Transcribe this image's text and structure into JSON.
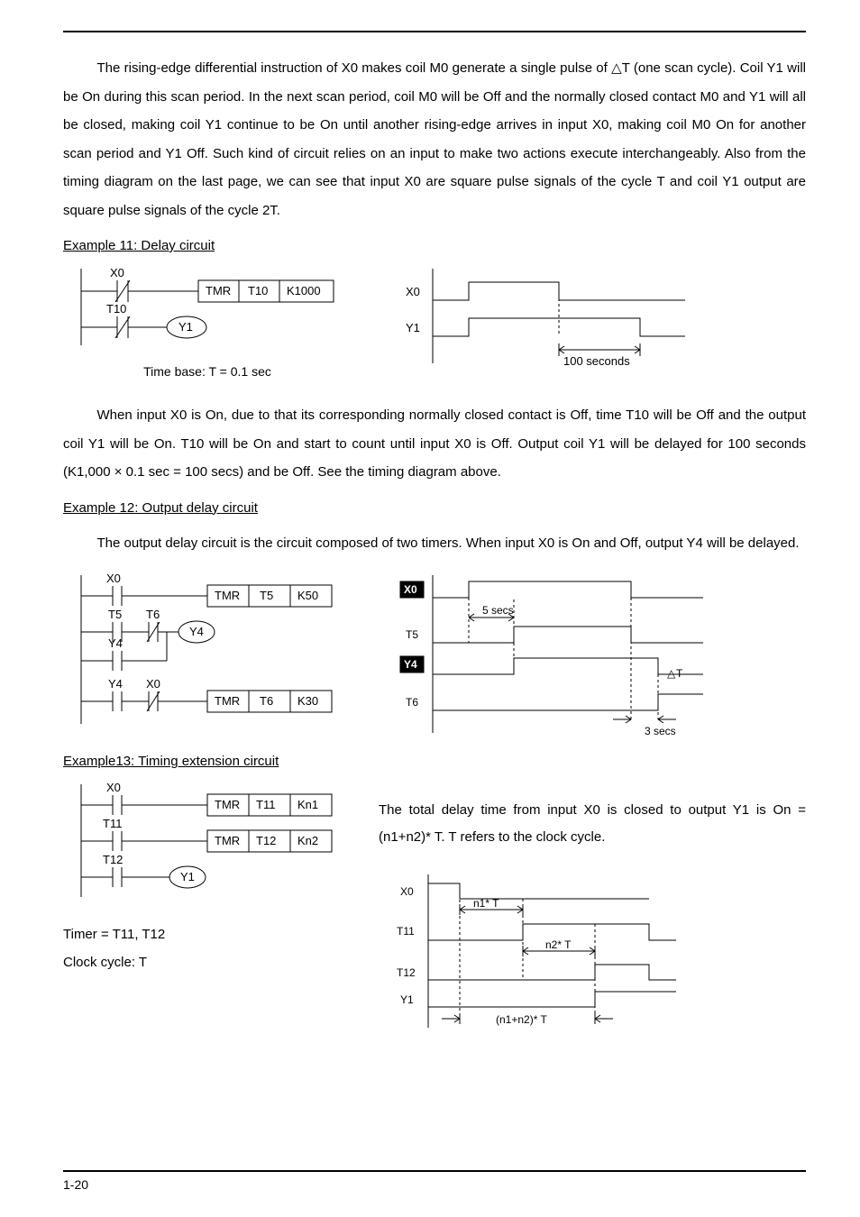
{
  "paragraphs": {
    "intro": "The rising-edge differential instruction of X0 makes coil M0 generate a single pulse of △T (one scan cycle). Coil Y1 will be On during this scan period. In the next scan period, coil M0 will be Off and the normally closed contact M0 and Y1 will all be closed, making coil Y1 continue to be On until another rising-edge arrives in input X0, making coil M0 On for another scan period and Y1 Off. Such kind of circuit relies on an input to make two actions execute interchangeably. Also from the timing diagram on the last page, we can see that input X0 are square pulse signals of the cycle T and coil Y1 output are square pulse signals of the cycle 2T.",
    "ex11_title": "Example 11: Delay circuit",
    "ex11_caption": "Time  base:  T  =  0.1  sec",
    "ex11_body": "When input X0 is On, due to that its corresponding normally closed contact is Off, time T10 will be Off and the output coil Y1 will be On. T10 will be On and start to count until input X0 is Off. Output coil Y1 will be delayed for 100 seconds (K1,000 × 0.1 sec = 100 secs) and be Off. See the timing diagram above.",
    "ex12_title": "Example 12: Output delay circuit",
    "ex12_body": "The output delay circuit is the circuit composed of two timers. When input X0 is On and Off, output Y4 will be delayed.",
    "ex13_title": "Example13: Timing extension circuit",
    "ex13_body": "The total delay time from input X0 is closed to output Y1 is On = (n1+n2)* T. T refers to the clock cycle.",
    "ex13_timer_line": "Timer = T11, T12",
    "ex13_clock_line": "Clock cycle: T"
  },
  "ladder_ex11": {
    "rung1_contact": "X0",
    "rung1_instr": [
      "TMR",
      "T10",
      "K1000"
    ],
    "rung2_contact": "T10",
    "rung2_coil": "Y1"
  },
  "timing_ex11": {
    "row1": "X0",
    "row2": "Y1",
    "note": "100 seconds"
  },
  "ladder_ex12": {
    "rung1_contact": "X0",
    "rung1_instr": [
      "TMR",
      "T5",
      "K50"
    ],
    "rung2_c1": "T5",
    "rung2_c2": "T6",
    "rung2_coil": "Y4",
    "rung2_or": "Y4",
    "rung3_c1": "Y4",
    "rung3_c2": "X0",
    "rung3_instr": [
      "TMR",
      "T6",
      "K30"
    ]
  },
  "timing_ex12": {
    "rows": [
      "X0",
      "T5",
      "Y4",
      "T6"
    ],
    "note_top": "5 secs",
    "note_bottom": "3 secs",
    "note_right": "T"
  },
  "ladder_ex13": {
    "rung1_contact": "X0",
    "rung1_instr": [
      "TMR",
      "T11",
      "Kn1"
    ],
    "rung2_contact": "T11",
    "rung2_instr": [
      "TMR",
      "T12",
      "Kn2"
    ],
    "rung3_contact": "T12",
    "rung3_coil": "Y1"
  },
  "timing_ex13": {
    "rows": [
      "X0",
      "T11",
      "T12",
      "Y1"
    ],
    "note1": "n1* T",
    "note2": "n2* T",
    "note3": "(n1+n2)* T"
  },
  "footer": {
    "page": "1-20"
  }
}
